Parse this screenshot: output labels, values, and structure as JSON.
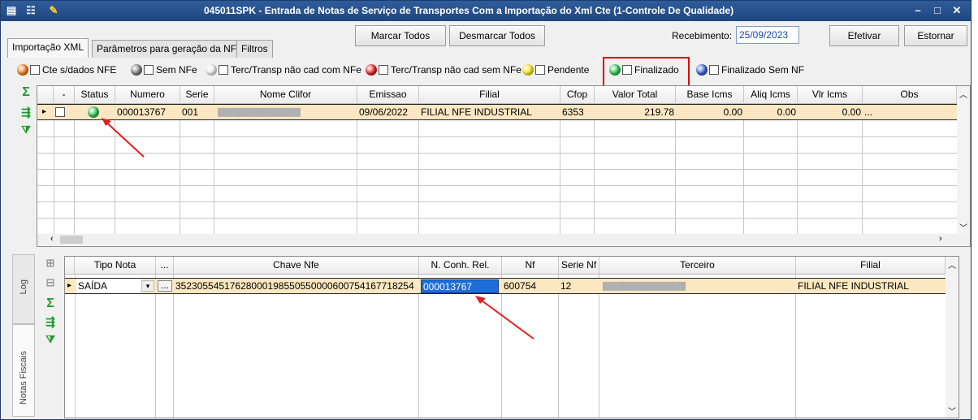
{
  "window": {
    "title": "045011SPK - Entrada de Notas de Serviço de Transportes Com a Importação do Xml Cte (1-Controle De Qualidade)",
    "icons": [
      "grid-icon",
      "tree-icon",
      "wrench-icon"
    ],
    "controls": {
      "minimize": "–",
      "maximize": "□",
      "close": "✕"
    }
  },
  "tabs": [
    {
      "label": "Importação XML",
      "active": true
    },
    {
      "label": "Parâmetros para geração da NF",
      "active": false
    },
    {
      "label": "Filtros",
      "active": false
    }
  ],
  "toolbar": {
    "marcar_todos": "Marcar Todos",
    "desmarcar_todos": "Desmarcar Todos",
    "recebimento_label": "Recebimento:",
    "recebimento_value": "25/09/2023",
    "efetivar": "Efetivar",
    "estornar": "Estornar"
  },
  "legend": [
    {
      "label": "Cte s/dados NFE",
      "color": "#f07a1a"
    },
    {
      "label": "Sem NFe",
      "color": "#7a7a7a"
    },
    {
      "label": "Terc/Transp não cad com NFe",
      "color": "#e9e9e9"
    },
    {
      "label": "Terc/Transp não cad sem NFe",
      "color": "#e02020"
    },
    {
      "label": "Pendente",
      "color": "#f2e21b"
    },
    {
      "label": "Finalizado",
      "color": "#2fbf55"
    },
    {
      "label": "Finalizado Sem NF",
      "color": "#3060d8"
    }
  ],
  "top_grid": {
    "columns": [
      "-",
      "Status",
      "Numero",
      "Serie",
      "Nome Clifor",
      "Emissao",
      "Filial",
      "Cfop",
      "Valor Total",
      "Base Icms",
      "Aliq Icms",
      "Vlr Icms",
      "Obs"
    ],
    "row": {
      "status_color": "#2fbf55",
      "numero": "000013767",
      "serie": "001",
      "nome_clifor": "████████████████",
      "emissao": "09/06/2022",
      "filial": "FILIAL NFE INDUSTRIAL",
      "cfop": "6353",
      "valor_total": "219.78",
      "base_icms": "0.00",
      "aliq_icms": "0.00",
      "vlr_icms": "0.00",
      "obs": "..."
    }
  },
  "bottom_grid": {
    "columns": [
      "Tipo Nota",
      "...",
      "Chave Nfe",
      "N. Conh. Rel.",
      "Nf",
      "Serie Nf",
      "Terceiro",
      "Filial"
    ],
    "row": {
      "tipo_nota": "SAÍDA",
      "ellipsis": "...",
      "chave_nfe": "35230554517628000198550550000600754167718254",
      "n_conh_rel": "000013767",
      "nf": "600754",
      "serie_nf": "12",
      "terceiro": "████████████████",
      "filial": "FILIAL NFE INDUSTRIAL"
    }
  },
  "side_tabs": {
    "log": "Log",
    "notas": "Notas Fiscais"
  }
}
